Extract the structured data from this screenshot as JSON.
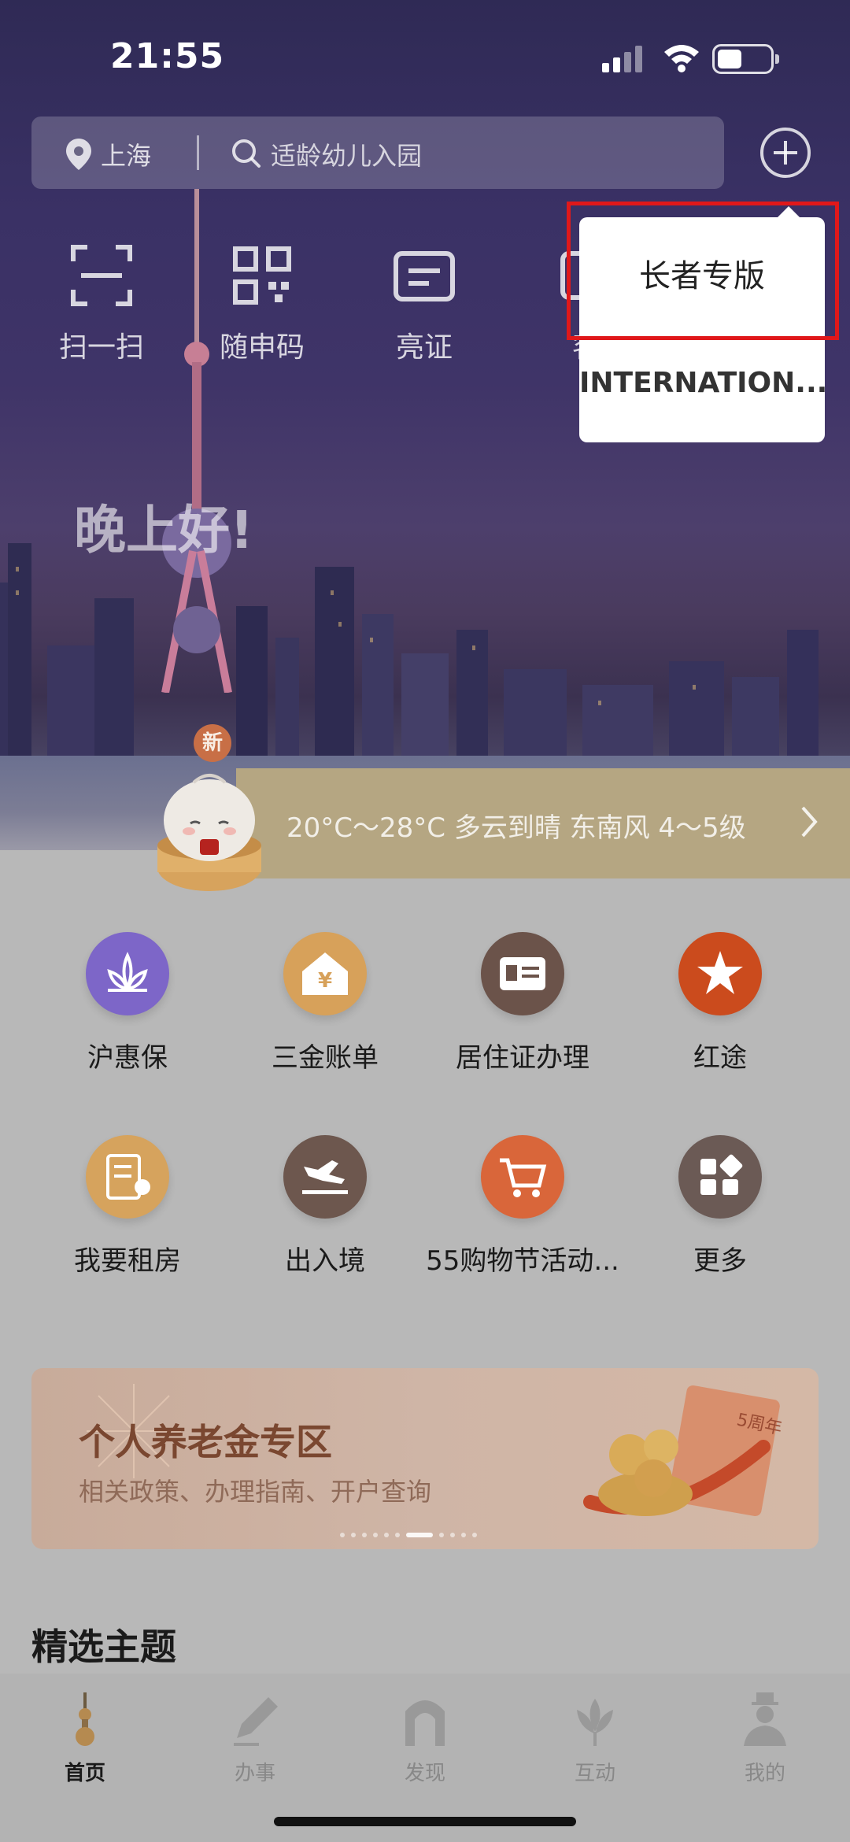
{
  "status_bar": {
    "time": "21:55"
  },
  "search": {
    "city": "上海",
    "placeholder": "适龄幼儿入园"
  },
  "quick_actions": [
    {
      "label": "扫一扫",
      "icon": "scan-icon"
    },
    {
      "label": "随申码",
      "icon": "qr-code-icon"
    },
    {
      "label": "亮证",
      "icon": "card-icon"
    },
    {
      "label": "客",
      "icon": "service-icon"
    }
  ],
  "greeting": "晚上好!",
  "weather": {
    "badge": "新",
    "text": "20°C～28°C 多云到晴 东南风 4～5级"
  },
  "services": [
    {
      "label": "沪惠保",
      "icon": "lotus-icon",
      "color": "#7d66c8"
    },
    {
      "label": "三金账单",
      "icon": "yuan-house-icon",
      "color": "#d7a15a"
    },
    {
      "label": "居住证办理",
      "icon": "residence-card-icon",
      "color": "#6b534a"
    },
    {
      "label": "红途",
      "icon": "red-star-icon",
      "color": "#cb4b1d"
    },
    {
      "label": "我要租房",
      "icon": "rent-doc-icon",
      "color": "#d6a35d"
    },
    {
      "label": "出入境",
      "icon": "plane-icon",
      "color": "#6d574e"
    },
    {
      "label": "55购物节活动...",
      "icon": "cart-icon",
      "color": "#d9663a"
    },
    {
      "label": "更多",
      "icon": "more-grid-icon",
      "color": "#6b5a55"
    }
  ],
  "banner": {
    "title": "个人养老金专区",
    "subtitle": "相关政策、办理指南、开户查询",
    "badge": "5周年"
  },
  "section_title": "精选主题",
  "tabs": [
    {
      "label": "首页",
      "icon": "tower-icon",
      "active": true
    },
    {
      "label": "办事",
      "icon": "pen-icon",
      "active": false
    },
    {
      "label": "发现",
      "icon": "arch-icon",
      "active": false
    },
    {
      "label": "互动",
      "icon": "flower-icon",
      "active": false
    },
    {
      "label": "我的",
      "icon": "person-icon",
      "active": false
    }
  ],
  "popup": {
    "items": [
      "长者专版",
      "INTERNATION..."
    ]
  }
}
